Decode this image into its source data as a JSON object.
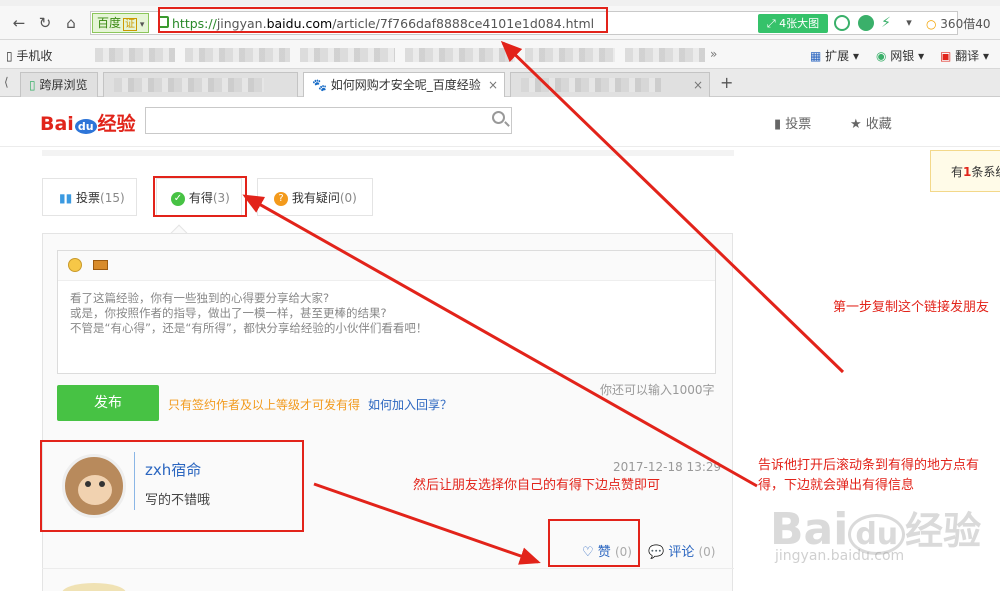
{
  "browser": {
    "address": {
      "site_tag": "百度",
      "site_cert": "证",
      "url_scheme": "https://",
      "url_domain_pre": "jingyan.",
      "url_domain": "baidu.com",
      "url_path": "/article/7f766daf8888ce4101e1d084.html",
      "zoom_button": "4张大图",
      "search_engine": "360借40"
    },
    "bookmarks": {
      "mobile": "手机收",
      "extensions": "扩展",
      "net_bank": "网银",
      "translate": "翻译"
    },
    "tabs": [
      {
        "label": "跨屏浏览",
        "active": false
      },
      {
        "label": "如何网购才安全呢_百度经验",
        "active": true
      }
    ]
  },
  "page": {
    "logo": {
      "bai": "Bai",
      "du": "du",
      "jingyan": "经验"
    },
    "header_links": {
      "vote": "投票",
      "favorite": "收藏"
    },
    "notification": {
      "prefix": "有",
      "count": "1",
      "suffix": "条系统"
    },
    "content_tabs": [
      {
        "label": "投票",
        "count": "(15)"
      },
      {
        "label": "有得",
        "count": "(3)"
      },
      {
        "label": "我有疑问",
        "count": "(0)"
      }
    ],
    "editor": {
      "placeholder_lines": [
        "看了这篇经验，你有一些独到的心得要分享给大家?",
        "或是，你按照作者的指导，做出了一模一样，甚至更棒的结果?",
        "不管是“有心得”，还是“有所得”，都快分享给经验的小伙伴们看看吧！"
      ],
      "counter": "你还可以输入1000字",
      "publish": "发布",
      "sign_tip": "只有签约作者及以上等级才可发有得",
      "join_link": "如何加入回享？"
    },
    "comment": {
      "user": "zxh宿命",
      "text": "写的不错哦",
      "time": "2017-12-18 13:29",
      "like_label": "赞",
      "like_count": "(0)",
      "comment_label": "评论",
      "comment_count": "(0)"
    }
  },
  "annotations": {
    "step1": "第一步复制这个链接发朋友",
    "step2": "告诉他打开后滚动条到有得的地方点有得，下边就会弹出有得信息",
    "step3": "然后让朋友选择你自己的有得下边点赞即可"
  },
  "watermark": {
    "brand_bai": "Bai",
    "brand_du": "du",
    "brand_jy": "经验",
    "url": "jingyan.baidu.com"
  },
  "colors": {
    "annotation_red": "#e2231a",
    "publish_green": "#47c244",
    "link_blue": "#2b66c0"
  }
}
